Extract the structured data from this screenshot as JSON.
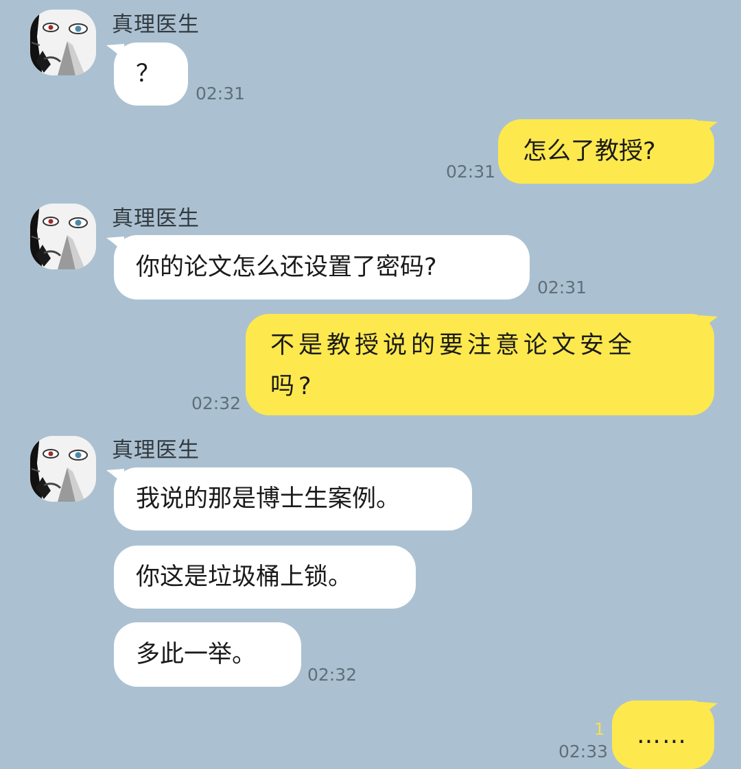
{
  "contact": {
    "name": "真理医生"
  },
  "messages": [
    {
      "from": "in",
      "text": "？",
      "time": "02:31"
    },
    {
      "from": "out",
      "text": "怎么了教授?",
      "time": "02:31"
    },
    {
      "from": "in",
      "text": "你的论文怎么还设置了密码?",
      "time": "02:31"
    },
    {
      "from": "out",
      "lines": [
        "不是教授说的要注意论文安全",
        "吗?"
      ],
      "time": "02:32"
    },
    {
      "from": "in",
      "text": "我说的那是博士生案例。"
    },
    {
      "from": "in",
      "text": "你这是垃圾桶上锁。"
    },
    {
      "from": "in",
      "text": "多此一举。",
      "time": "02:32"
    },
    {
      "from": "out",
      "text": "……",
      "time": "02:33",
      "unread": "1"
    }
  ],
  "colors": {
    "background": "#abc1d1",
    "incoming_bubble": "#ffffff",
    "outgoing_bubble": "#fde84e",
    "timestamp": "#5f6e79",
    "unread": "#f7e14a"
  }
}
